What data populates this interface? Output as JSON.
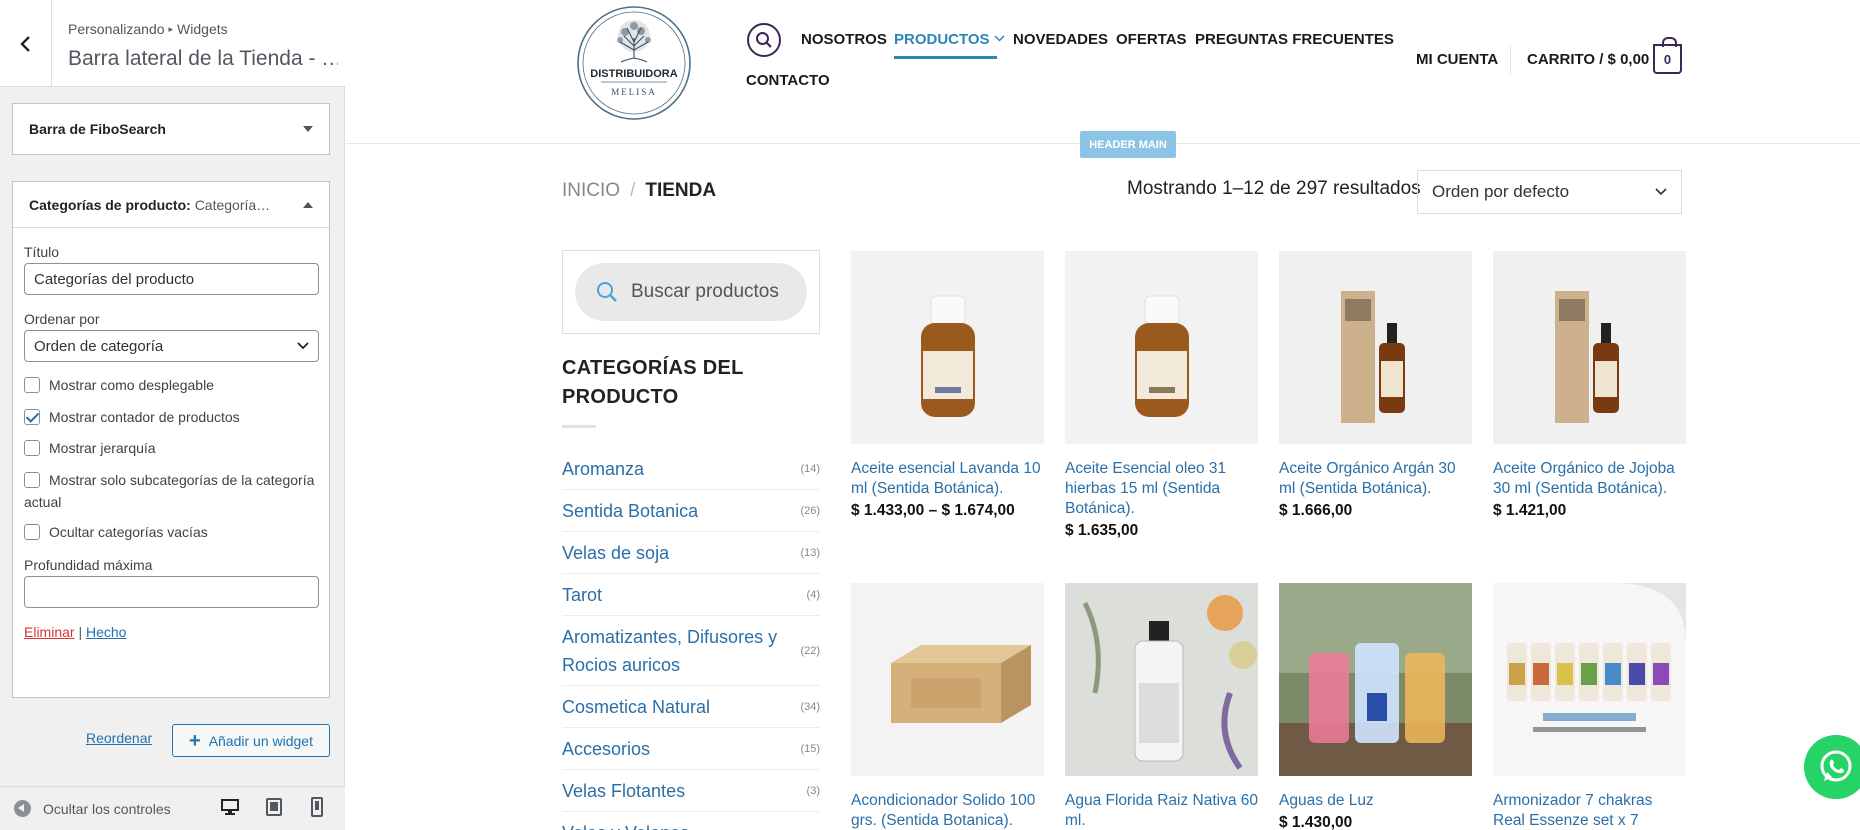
{
  "customizer": {
    "breadcrumb": [
      "Personalizando",
      "Widgets"
    ],
    "title": "Barra lateral de la Tienda - …",
    "fibo_section": {
      "title": "Barra de FiboSearch"
    },
    "cats_section": {
      "title": "Categorías de producto:",
      "subtitle": "Categoría…",
      "title_label": "Título",
      "title_value": "Categorías del producto",
      "order_label": "Ordenar por",
      "order_value": "Orden de categoría",
      "options": [
        {
          "label": "Mostrar como desplegable",
          "checked": false
        },
        {
          "label": "Mostrar contador de productos",
          "checked": true
        },
        {
          "label": "Mostrar jerarquía",
          "checked": false
        },
        {
          "label": "Mostrar solo subcategorías de la categoría actual",
          "checked": false
        },
        {
          "label": "Ocultar categorías vacías",
          "checked": false
        }
      ],
      "depth_label": "Profundidad máxima",
      "depth_value": "",
      "delete_label": "Eliminar",
      "done_label": "Hecho",
      "link_separator": "|"
    },
    "reorder_label": "Reordenar",
    "add_widget_label": "Añadir un widget",
    "hide_controls_label": "Ocultar los controles"
  },
  "site": {
    "logo": {
      "top_text": "DISTRIBUIDORA",
      "bottom_text": "MELISA"
    },
    "nav": [
      "NOSOTROS",
      "PRODUCTOS",
      "NOVEDADES",
      "OFERTAS",
      "PREGUNTAS FRECUENTES",
      "CONTACTO"
    ],
    "account_label": "MI CUENTA",
    "cart_label": "CARRITO / $ 0,00",
    "cart_count": "0",
    "header_badge": "HEADER MAIN",
    "colors": {
      "accent": "#2a87b8",
      "brand_purple": "#3b2559",
      "link": "#2a6fa8",
      "whatsapp": "#25d366"
    }
  },
  "shop": {
    "breadcrumb": {
      "home": "INICIO",
      "sep": "/",
      "current": "TIENDA"
    },
    "result_count": "Mostrando 1–12 de 297 resultados",
    "orderby": "Orden por defecto",
    "search_placeholder": "Buscar productos",
    "categories_title": "CATEGORÍAS DEL PRODUCTO",
    "categories": [
      {
        "name": "Aromanza",
        "count": "(14)"
      },
      {
        "name": "Sentida Botanica",
        "count": "(26)"
      },
      {
        "name": "Velas de soja",
        "count": "(13)"
      },
      {
        "name": "Tarot",
        "count": "(4)"
      },
      {
        "name": "Aromatizantes, Difusores y Rocios auricos",
        "count": "(22)"
      },
      {
        "name": "Cosmetica Natural",
        "count": "(34)"
      },
      {
        "name": "Accesorios",
        "count": "(15)"
      },
      {
        "name": "Velas Flotantes",
        "count": "(3)"
      },
      {
        "name": "Velas y Velones",
        "count": ""
      }
    ],
    "products": [
      {
        "name": "Aceite esencial Lavanda 10 ml (Sentida Botánica).",
        "price": "$ 1.433,00 – $ 1.674,00",
        "image": "amber-bottle"
      },
      {
        "name": "Aceite Esencial oleo 31 hierbas 15 ml (Sentida Botánica).",
        "price": "$ 1.635,00",
        "image": "amber-bottle"
      },
      {
        "name": "Aceite Orgánico Argán 30 ml (Sentida Botánica).",
        "price": "$ 1.666,00",
        "image": "dropper-box"
      },
      {
        "name": "Aceite Orgánico de Jojoba 30 ml (Sentida Botánica).",
        "price": "$ 1.421,00",
        "image": "dropper-box"
      },
      {
        "name": "Acondicionador Solido 100 grs. (Sentida Botanica).",
        "price": "",
        "image": "kraft-box"
      },
      {
        "name": "Agua Florida Raiz Nativa 60 ml.",
        "price": "",
        "image": "spray-bottle"
      },
      {
        "name": "Aguas de Luz",
        "price": "$ 1.430,00",
        "image": "spray-trio"
      },
      {
        "name": "Armonizador 7 chakras Real Essenze set x 7",
        "price": "",
        "image": "spray-set"
      }
    ]
  }
}
